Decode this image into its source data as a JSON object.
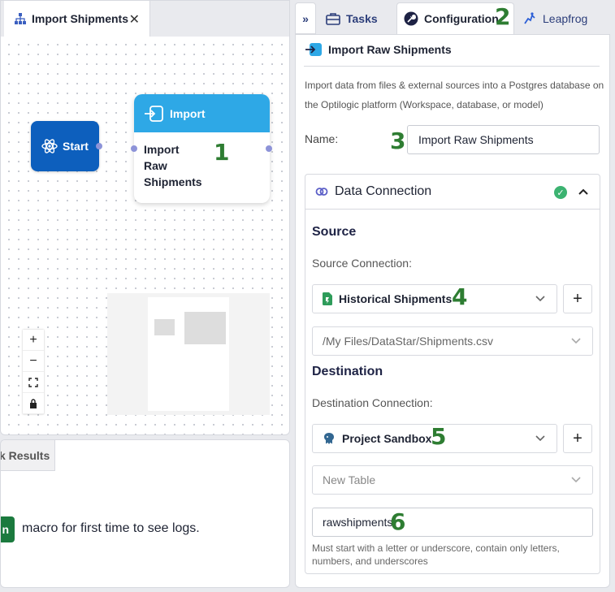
{
  "canvas": {
    "tab_label": "Import Shipments",
    "close_glyph": "✕",
    "start_node_label": "Start",
    "import_node_header": "Import",
    "import_node_body": "Import Raw Shipments",
    "zoom_controls": [
      "+",
      "−",
      "⛶",
      "🔒"
    ]
  },
  "callouts": [
    "1",
    "2",
    "3",
    "4",
    "5",
    "6"
  ],
  "results": {
    "tab_label": "k Results",
    "run_chip": "n",
    "message": "macro for first time to see logs."
  },
  "right_tabs": {
    "expand_glyph": "»",
    "tasks": "Tasks",
    "configuration": "Configuration",
    "leapfrog": "Leapfrog"
  },
  "config": {
    "title": "Import Raw Shipments",
    "description": "Import data from files & external sources into a Postgres database on the Optilogic platform (Workspace, database, or model)",
    "name_label": "Name:",
    "name_value": "Import Raw Shipments",
    "data_connection_label": "Data Connection",
    "source_heading": "Source",
    "source_connection_label": "Source Connection:",
    "source_connection_value": "Historical Shipments",
    "source_file_value": "/My Files/DataStar/Shipments.csv",
    "destination_heading": "Destination",
    "destination_connection_label": "Destination Connection:",
    "destination_connection_value": "Project Sandbox",
    "destination_table_placeholder": "New Table",
    "table_name_value": "rawshipments",
    "table_name_hint": "Must start with a letter or underscore, contain only letters, numbers, and underscores",
    "plus_glyph": "+"
  },
  "colors": {
    "start_node": "#0d5fbd",
    "import_header": "#2ea8e6",
    "callout": "#2e7d32",
    "check": "#3cb371",
    "run_chip": "#1b7a3e"
  }
}
